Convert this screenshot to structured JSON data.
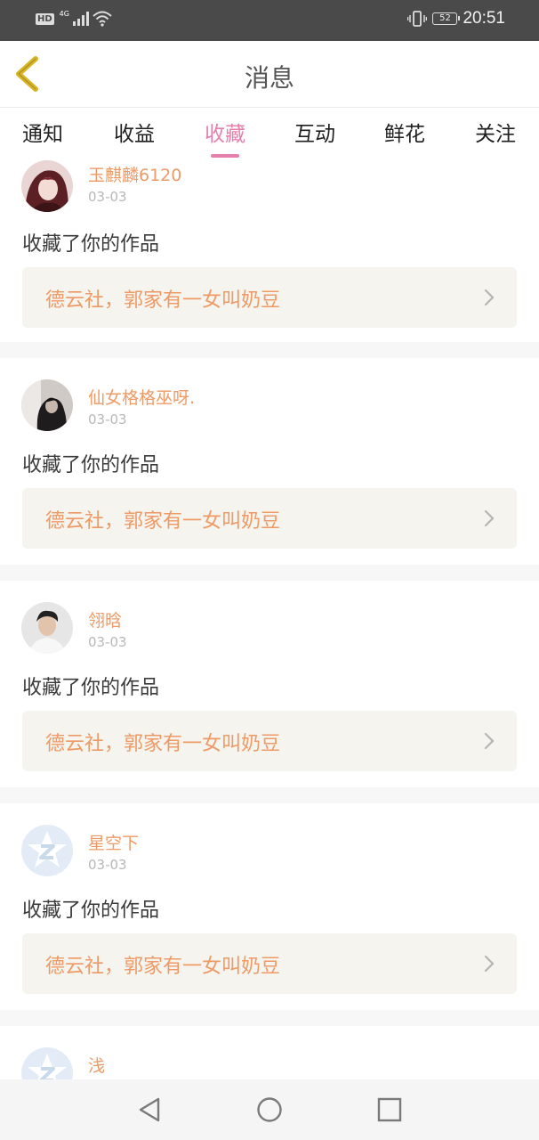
{
  "status_bar": {
    "time": "20:51",
    "battery": "52",
    "network": "4G",
    "hd": "HD"
  },
  "header": {
    "title": "消息"
  },
  "tabs": [
    {
      "label": "通知",
      "active": false
    },
    {
      "label": "收益",
      "active": false
    },
    {
      "label": "收藏",
      "active": true
    },
    {
      "label": "互动",
      "active": false
    },
    {
      "label": "鲜花",
      "active": false
    },
    {
      "label": "关注",
      "active": false
    }
  ],
  "messages": [
    {
      "user": "玉麒麟6120",
      "date": "03-03",
      "action": "收藏了你的作品",
      "work": "德云社，郭家有一女叫奶豆",
      "avatar": "drawn-portrait"
    },
    {
      "user": "仙女格格巫呀.",
      "date": "03-03",
      "action": "收藏了你的作品",
      "work": "德云社，郭家有一女叫奶豆",
      "avatar": "dark-photo"
    },
    {
      "user": "翎晗",
      "date": "03-03",
      "action": "收藏了你的作品",
      "work": "德云社，郭家有一女叫奶豆",
      "avatar": "person-photo"
    },
    {
      "user": "星空下",
      "date": "03-03",
      "action": "收藏了你的作品",
      "work": "德云社，郭家有一女叫奶豆",
      "avatar": "default-star-z"
    },
    {
      "user": "浅",
      "date": "",
      "action": "",
      "work": "",
      "avatar": "default-star-z"
    }
  ],
  "colors": {
    "accent": "#e67fae",
    "username": "#ee9a66",
    "work_box": "#f5f4ee",
    "back_icon": "#d9b528"
  },
  "nav_bar": {
    "icons": [
      "back-triangle-icon",
      "home-circle-icon",
      "recents-square-icon"
    ]
  }
}
